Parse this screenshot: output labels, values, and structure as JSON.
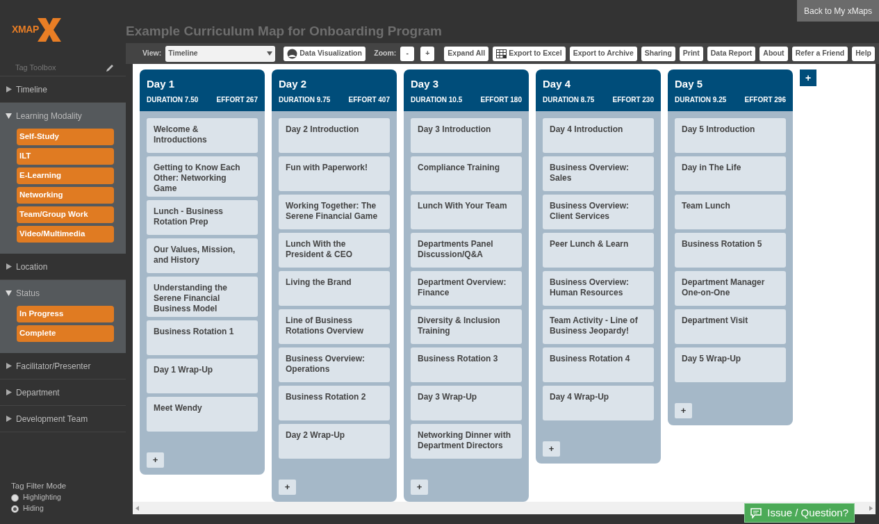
{
  "header": {
    "logo": "XMAP",
    "title": "Example Curriculum Map for Onboarding Program",
    "back_button": "Back to My xMaps"
  },
  "toolbar": {
    "view_label": "View:",
    "view_value": "Timeline",
    "data_viz": "Data Visualization",
    "zoom_label": "Zoom:",
    "zoom_out": "-",
    "zoom_in": "+",
    "buttons": [
      {
        "label": "Expand All",
        "kind": "plain"
      },
      {
        "label": "Export to Excel",
        "kind": "grid"
      },
      {
        "label": "Export to Archive",
        "kind": "plain"
      },
      {
        "label": "Sharing",
        "kind": "plain"
      },
      {
        "label": "Print",
        "kind": "plain"
      },
      {
        "label": "Data Report",
        "kind": "plain"
      },
      {
        "label": "About",
        "kind": "plain"
      },
      {
        "label": "Refer a Friend",
        "kind": "plain"
      },
      {
        "label": "Help",
        "kind": "plain"
      }
    ]
  },
  "sidebar": {
    "toolbox_label": "Tag Toolbox",
    "sections": [
      {
        "label": "Timeline",
        "expanded": false
      },
      {
        "label": "Learning Modality",
        "expanded": true,
        "tags": [
          "Self-Study",
          "ILT",
          "E-Learning",
          "Networking",
          "Team/Group Work",
          "Video/Multimedia"
        ]
      },
      {
        "label": "Location",
        "expanded": false
      },
      {
        "label": "Status",
        "expanded": true,
        "tags": [
          "In Progress",
          "Complete"
        ]
      },
      {
        "label": "Facilitator/Presenter",
        "expanded": false
      },
      {
        "label": "Department",
        "expanded": false
      },
      {
        "label": "Development Team",
        "expanded": false
      }
    ],
    "filter_mode": {
      "label": "Tag Filter Mode",
      "options": [
        {
          "label": "Highlighting",
          "selected": false
        },
        {
          "label": "Hiding",
          "selected": true
        }
      ]
    }
  },
  "days": [
    {
      "title": "Day 1",
      "duration": "DURATION 7.50",
      "effort": "EFFORT 267",
      "add": "+",
      "items": [
        "Welcome & Introductions",
        "Getting to Know Each Other: Networking Game",
        "Lunch - Business Rotation Prep",
        "Our Values, Mission, and History",
        "Understanding the Serene Financial Business Model",
        "Business Rotation 1",
        "Day 1 Wrap-Up",
        "Meet Wendy"
      ]
    },
    {
      "title": "Day 2",
      "duration": "DURATION 9.75",
      "effort": "EFFORT 407",
      "add": "+",
      "items": [
        "Day 2 Introduction",
        "Fun with Paperwork!",
        "Working Together: The Serene Financial Game",
        "Lunch With the President & CEO",
        "Living the Brand",
        "Line of Business Rotations Overview",
        "Business Overview: Operations",
        "Business Rotation 2",
        "Day 2 Wrap-Up"
      ]
    },
    {
      "title": "Day 3",
      "duration": "DURATION 10.5",
      "effort": "EFFORT 180",
      "add": "+",
      "items": [
        "Day 3 Introduction",
        "Compliance Training",
        "Lunch With Your Team",
        "Departments Panel Discussion/Q&A",
        "Department Overview: Finance",
        "Diversity & Inclusion Training",
        "Business Rotation 3",
        "Day 3 Wrap-Up",
        "Networking Dinner with Department Directors"
      ]
    },
    {
      "title": "Day 4",
      "duration": "DURATION 8.75",
      "effort": "EFFORT 230",
      "add": "+",
      "items": [
        "Day 4 Introduction",
        "Business Overview: Sales",
        "Business Overview: Client Services",
        "Peer Lunch & Learn",
        "Business Overview: Human Resources",
        "Team Activity - Line of Business Jeopardy!",
        "Business Rotation 4",
        "Day 4 Wrap-Up"
      ]
    },
    {
      "title": "Day 5",
      "duration": "DURATION 9.25",
      "effort": "EFFORT 296",
      "add": "+",
      "items": [
        "Day 5 Introduction",
        "Day in The Life",
        "Team Lunch",
        "Business Rotation 5",
        "Department Manager One-on-One",
        "Department Visit",
        "Day 5 Wrap-Up"
      ]
    }
  ],
  "add_day": "+",
  "feedback_button": "Issue / Question?"
}
